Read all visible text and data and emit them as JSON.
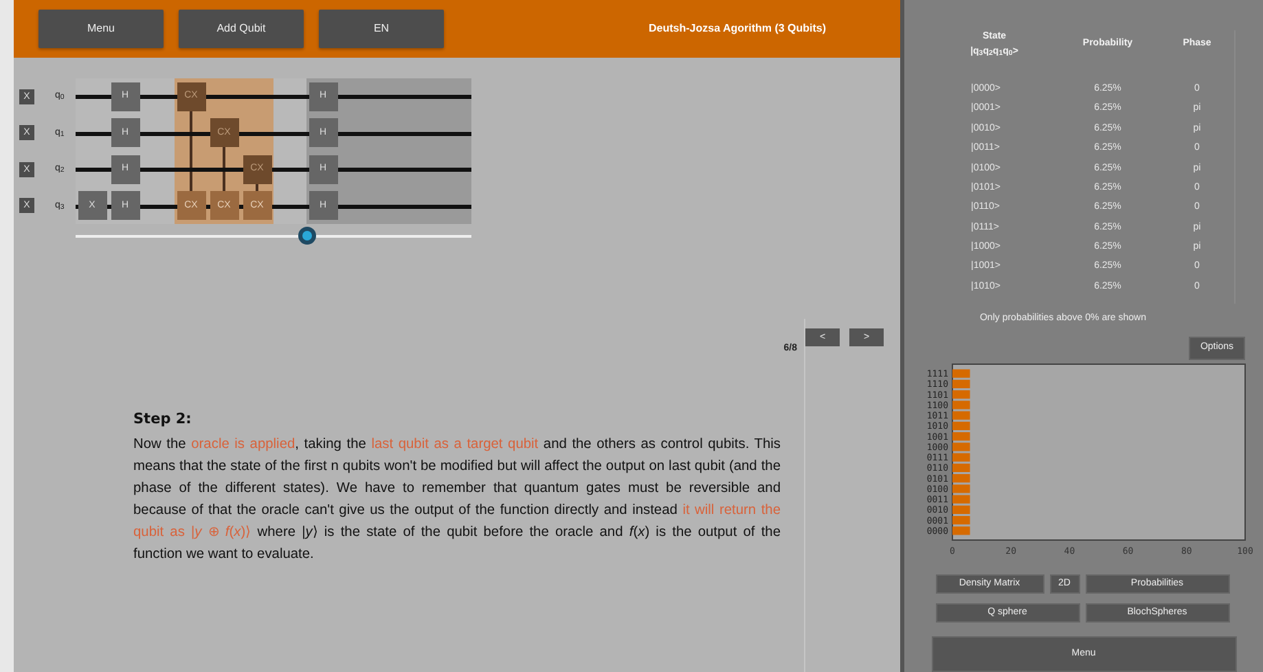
{
  "top_bar": {
    "buttons": [
      "Menu",
      "Add Qubit",
      "EN"
    ],
    "title": "Deutsh-Jozsa Agorithm (3 Qubits)"
  },
  "circuit": {
    "qubits": [
      {
        "reset": "X",
        "label": "q$_{0}$"
      },
      {
        "reset": "X",
        "label": "q$_{1}$"
      },
      {
        "reset": "X",
        "label": "q$_{2}$"
      },
      {
        "reset": "X",
        "label": "q$_{3}$"
      }
    ],
    "columns": [
      {
        "highlighted": false,
        "dimmed": false,
        "cells": [
          {
            "kind": "empty"
          },
          {
            "kind": "empty"
          },
          {
            "kind": "empty"
          },
          {
            "kind": "gate",
            "label": "X"
          }
        ]
      },
      {
        "highlighted": false,
        "dimmed": false,
        "cells": [
          {
            "kind": "gate",
            "label": "H"
          },
          {
            "kind": "gate",
            "label": "H"
          },
          {
            "kind": "gate",
            "label": "H"
          },
          {
            "kind": "gate",
            "label": "H"
          }
        ]
      },
      {
        "highlighted": false,
        "dimmed": false,
        "cells": [
          {
            "kind": "empty"
          },
          {
            "kind": "empty"
          },
          {
            "kind": "empty"
          },
          {
            "kind": "empty"
          }
        ]
      },
      {
        "highlighted": true,
        "dimmed": false,
        "cells": [
          {
            "kind": "control",
            "label": "CX"
          },
          {
            "kind": "empty"
          },
          {
            "kind": "empty"
          },
          {
            "kind": "target",
            "label": "CX"
          }
        ]
      },
      {
        "highlighted": true,
        "dimmed": false,
        "cells": [
          {
            "kind": "empty"
          },
          {
            "kind": "control",
            "label": "CX"
          },
          {
            "kind": "empty"
          },
          {
            "kind": "target",
            "label": "CX"
          }
        ]
      },
      {
        "highlighted": true,
        "dimmed": false,
        "cells": [
          {
            "kind": "empty"
          },
          {
            "kind": "empty"
          },
          {
            "kind": "control",
            "label": "CX"
          },
          {
            "kind": "target",
            "label": "CX"
          }
        ]
      },
      {
        "highlighted": false,
        "dimmed": false,
        "cells": [
          {
            "kind": "empty"
          },
          {
            "kind": "empty"
          },
          {
            "kind": "empty"
          },
          {
            "kind": "empty"
          }
        ]
      },
      {
        "highlighted": false,
        "dimmed": true,
        "cells": [
          {
            "kind": "gate",
            "label": "H"
          },
          {
            "kind": "gate",
            "label": "H"
          },
          {
            "kind": "gate",
            "label": "H"
          },
          {
            "kind": "gate",
            "label": "H"
          }
        ]
      },
      {
        "highlighted": false,
        "dimmed": true,
        "cells": [
          {
            "kind": "empty"
          },
          {
            "kind": "empty"
          },
          {
            "kind": "empty"
          },
          {
            "kind": "empty"
          }
        ]
      },
      {
        "highlighted": false,
        "dimmed": true,
        "cells": [
          {
            "kind": "empty"
          },
          {
            "kind": "empty"
          },
          {
            "kind": "empty"
          },
          {
            "kind": "empty"
          }
        ]
      },
      {
        "highlighted": false,
        "dimmed": true,
        "cells": [
          {
            "kind": "empty"
          },
          {
            "kind": "empty"
          },
          {
            "kind": "empty"
          },
          {
            "kind": "empty"
          }
        ]
      },
      {
        "highlighted": false,
        "dimmed": true,
        "cells": [
          {
            "kind": "empty"
          },
          {
            "kind": "empty"
          },
          {
            "kind": "empty"
          },
          {
            "kind": "empty"
          }
        ]
      }
    ],
    "slider": {
      "level": 0.585
    }
  },
  "navigation": {
    "counter": "6/8",
    "prev": "<",
    "next": ">"
  },
  "explanation": {
    "heading": "Step 2:",
    "parts": [
      {
        "kind": "plain",
        "text": "Now the "
      },
      {
        "kind": "highlight",
        "text": "oracle is applied"
      },
      {
        "kind": "plain",
        "text": ", taking the "
      },
      {
        "kind": "highlight",
        "text": "last qubit as a target qubit"
      },
      {
        "kind": "plain",
        "text": " and the others as control qubits.  This means that the state of the first n qubits won't be modified but will affect the output on last qubit (and the phase of the different states).  We have to remember that quantum gates must be reversible and because of that the oracle can't give us the output of the function directly and instead "
      },
      {
        "kind": "highlight",
        "text": "it will return the qubit as |*y* ⊕ *f*(*x*)⟩"
      },
      {
        "kind": "plain",
        "text": " where |*y*⟩ is the state of the qubit before the oracle and *f*(*x*) is the output of the function we want to evaluate."
      }
    ]
  },
  "state_table": {
    "columns": [
      "State",
      "|q$_{3}$q$_{2}$q$_{1}$q$_{0}$>",
      "Probability",
      "Phase"
    ],
    "rows": [
      {
        "state": "|0000>",
        "probability": "6.25%",
        "phase": "0"
      },
      {
        "state": "|0001>",
        "probability": "6.25%",
        "phase": "pi"
      },
      {
        "state": "|0010>",
        "probability": "6.25%",
        "phase": "pi"
      },
      {
        "state": "|0011>",
        "probability": "6.25%",
        "phase": "0"
      },
      {
        "state": "|0100>",
        "probability": "6.25%",
        "phase": "pi"
      },
      {
        "state": "|0101>",
        "probability": "6.25%",
        "phase": "0"
      },
      {
        "state": "|0110>",
        "probability": "6.25%",
        "phase": "0"
      },
      {
        "state": "|0111>",
        "probability": "6.25%",
        "phase": "pi"
      },
      {
        "state": "|1000>",
        "probability": "6.25%",
        "phase": "pi"
      },
      {
        "state": "|1001>",
        "probability": "6.25%",
        "phase": "0"
      },
      {
        "state": "|1010>",
        "probability": "6.25%",
        "phase": "0"
      }
    ],
    "note": "Only probabilities above 0% are shown"
  },
  "options_button": "Options",
  "chart": {
    "chart_data": {
      "type": "bar",
      "orientation": "horizontal",
      "categories": [
        "1111",
        "1110",
        "1101",
        "1100",
        "1011",
        "1010",
        "1001",
        "1000",
        "0111",
        "0110",
        "0101",
        "0100",
        "0011",
        "0010",
        "0001",
        "0000"
      ],
      "values": [
        6,
        6,
        6,
        6,
        6,
        6,
        6,
        6,
        6,
        6,
        6,
        6,
        6,
        6,
        6,
        6
      ],
      "xlim": [
        0,
        100
      ],
      "xticks": [
        0,
        20,
        40,
        60,
        80,
        100
      ]
    }
  },
  "view_buttons": {
    "density_matrix": "Density Matrix",
    "two_d": "2D",
    "probabilities": "Probabilities",
    "q_sphere": "Q sphere",
    "bloch_spheres": "BlochSpheres",
    "menu": "Menu"
  }
}
